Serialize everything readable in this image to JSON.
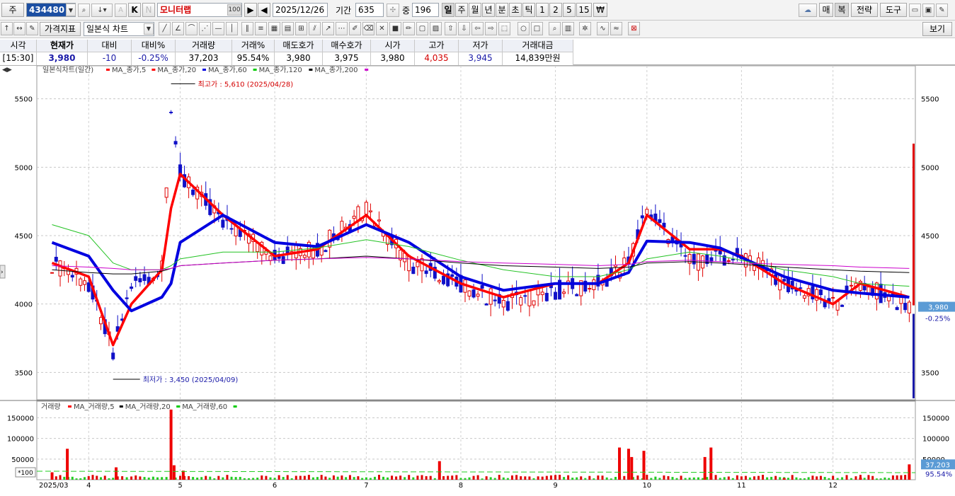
{
  "toolbar": {
    "type_label": "주",
    "code": "434480",
    "k_label": "K",
    "n_label": "N",
    "name": "모니터랩",
    "count_badge": "100",
    "date": "2025/12/26",
    "period_label": "기간",
    "period_value": "635",
    "middle_label": "중",
    "middle_value": "196",
    "period_tabs": [
      "일",
      "주",
      "월",
      "년",
      "분",
      "초",
      "틱",
      "1",
      "2",
      "5",
      "15",
      "₩"
    ],
    "right_buttons": [
      "매",
      "복",
      "전략",
      "도구"
    ],
    "price_indicator_label": "가격지표",
    "chart_type_label": "일본식 차트",
    "view_label": "보기"
  },
  "quote": {
    "headers": [
      "시각",
      "현재가",
      "대비",
      "대비%",
      "거래량",
      "거래%",
      "매도호가",
      "매수호가",
      "시가",
      "고가",
      "저가",
      "거래대금"
    ],
    "values": [
      "[15:30]",
      "3,980",
      "-10",
      "-0.25%",
      "37,203",
      "95.54%",
      "3,980",
      "3,975",
      "3,980",
      "4,035",
      "3,945",
      "14,839만원"
    ],
    "high_color": "#d40000",
    "low_color": "#1a1aa8"
  },
  "price_panel": {
    "legend_title": "일본식차트(일간)",
    "ma_labels": [
      "MA_종가,5",
      "MA_종가,20",
      "MA_종가,60",
      "MA_종가,120",
      "MA_종가,200"
    ],
    "ma_colors": [
      "#ff0000",
      "#ff0000",
      "#0000e0",
      "#00cc00",
      "#000000",
      "#cc00cc"
    ],
    "y_ticks": [
      "5500",
      "5000",
      "4500",
      "4000",
      "3500"
    ],
    "high_annotation": "최고가 : 5,610 (2025/04/28)",
    "low_annotation": "최저가 : 3,450 (2025/04/09)",
    "current_price_tag": "3,980",
    "current_change_tag": "-0.25%"
  },
  "volume_panel": {
    "legend_title": "거래량",
    "ma_labels": [
      "MA_거래량,5",
      "MA_거래량,20",
      "MA_거래량,60"
    ],
    "ma_colors": [
      "#ff0000",
      "#000000",
      "#00cc00"
    ],
    "y_ticks": [
      "150000",
      "100000",
      "50000"
    ],
    "unit_label": "*100",
    "current_volume_tag": "37,203",
    "current_ratio_tag": "95.54%"
  },
  "x_axis": {
    "labels": [
      "2025/03",
      "4",
      "5",
      "6",
      "7",
      "8",
      "9",
      "10",
      "11",
      "12"
    ]
  },
  "chart_data": [
    {
      "type": "candlestick",
      "title": "일본식차트(일간)",
      "xlabel": "",
      "ylabel": "",
      "x": [
        "2025-03-20",
        "2025-04-01",
        "2025-04-09",
        "2025-04-15",
        "2025-04-25",
        "2025-04-28",
        "2025-05-01",
        "2025-05-15",
        "2025-06-01",
        "2025-06-15",
        "2025-07-01",
        "2025-07-15",
        "2025-08-01",
        "2025-08-15",
        "2025-09-01",
        "2025-09-15",
        "2025-09-25",
        "2025-10-01",
        "2025-10-15",
        "2025-10-25",
        "2025-11-01",
        "2025-11-15",
        "2025-12-01",
        "2025-12-10",
        "2025-12-26"
      ],
      "close": [
        4300,
        4150,
        3650,
        4150,
        4250,
        5450,
        4950,
        4600,
        4350,
        4400,
        4700,
        4300,
        4150,
        4000,
        4100,
        4150,
        4300,
        4700,
        4300,
        4350,
        4350,
        4150,
        4000,
        4150,
        3980
      ],
      "series": [
        {
          "name": "MA_종가,5",
          "values": [
            4300,
            4200,
            3700,
            4000,
            4250,
            4700,
            4950,
            4650,
            4350,
            4400,
            4650,
            4350,
            4150,
            4050,
            4150,
            4150,
            4300,
            4650,
            4400,
            4400,
            4350,
            4150,
            4000,
            4150,
            4050
          ]
        },
        {
          "name": "MA_종가,60",
          "values": [
            4450,
            4350,
            4100,
            3950,
            4050,
            4150,
            4450,
            4650,
            4450,
            4420,
            4580,
            4450,
            4200,
            4100,
            4150,
            4150,
            4230,
            4460,
            4450,
            4410,
            4340,
            4200,
            4100,
            4080,
            4050
          ]
        },
        {
          "name": "MA_종가,120",
          "values": [
            4580,
            4500,
            4300,
            4250,
            4250,
            4280,
            4330,
            4380,
            4380,
            4410,
            4470,
            4420,
            4320,
            4250,
            4200,
            4200,
            4250,
            4330,
            4380,
            4350,
            4320,
            4250,
            4200,
            4150,
            4130
          ]
        },
        {
          "name": "MA_종가,200",
          "values": [
            4250,
            4230,
            4220,
            4220,
            4240,
            4260,
            4280,
            4300,
            4320,
            4330,
            4350,
            4330,
            4300,
            4280,
            4270,
            4260,
            4270,
            4300,
            4310,
            4300,
            4290,
            4270,
            4250,
            4240,
            4230
          ]
        },
        {
          "name": "MA_종가,20",
          "values": [
            4280,
            4270,
            4260,
            4250,
            4250,
            4260,
            4280,
            4300,
            4320,
            4330,
            4340,
            4330,
            4310,
            4300,
            4290,
            4280,
            4290,
            4310,
            4320,
            4310,
            4300,
            4290,
            4280,
            4270,
            4260
          ]
        }
      ],
      "ylim": [
        3300,
        5700
      ],
      "annotations": {
        "high": {
          "value": 5610,
          "date": "2025/04/28"
        },
        "low": {
          "value": 3450,
          "date": "2025/04/09"
        }
      }
    },
    {
      "type": "bar",
      "title": "거래량",
      "x": [
        "2025-03-20",
        "2025-03-25",
        "2025-04-10",
        "2025-04-28",
        "2025-04-29",
        "2025-05-02",
        "2025-07-25",
        "2025-09-22",
        "2025-09-25",
        "2025-09-26",
        "2025-09-30",
        "2025-10-20",
        "2025-10-22",
        "2025-11-15",
        "2025-12-10",
        "2025-12-26"
      ],
      "values": [
        18000,
        75000,
        30000,
        170000,
        35000,
        22000,
        45000,
        78000,
        75000,
        55000,
        70000,
        55000,
        78000,
        4000,
        5000,
        37203
      ],
      "ylim": [
        0,
        180000
      ]
    }
  ]
}
